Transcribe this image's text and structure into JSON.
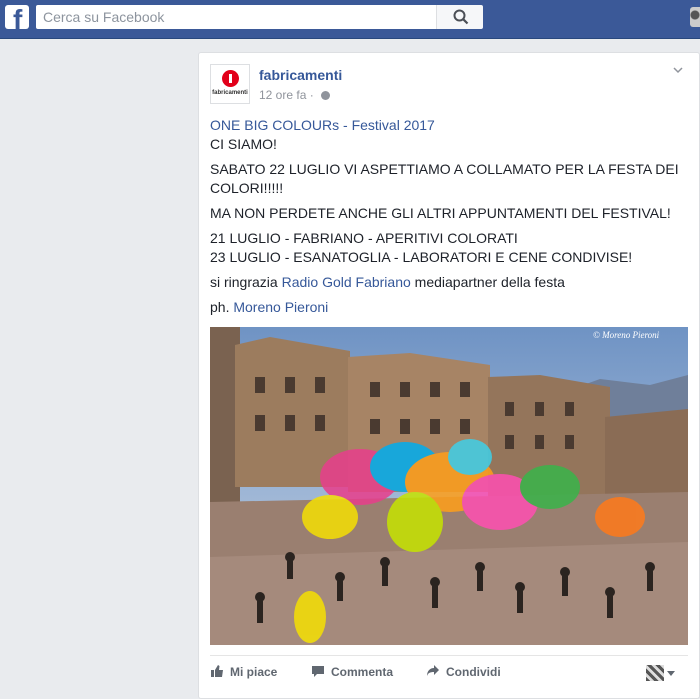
{
  "topbar": {
    "logo": "f",
    "search_placeholder": "Cerca su Facebook",
    "search_icon": "search-icon"
  },
  "post": {
    "page_name": "fabricamenti",
    "logo_text": "fabricamenti",
    "time": "12 ore fa",
    "time_sep": "·",
    "link_line": "ONE BIG COLOURs - Festival 2017",
    "line1": "CI SIAMO!",
    "line2": "SABATO 22 LUGLIO VI ASPETTIAMO A COLLAMATO PER LA FESTA DEI COLORI!!!!!",
    "line3": "MA NON PERDETE ANCHE GLI ALTRI APPUNTAMENTI DEL FESTIVAL!",
    "line4a": "21 LUGLIO - FABRIANO - APERITIVI COLORATI",
    "line4b": "23 LUGLIO - ESANATOGLIA - LABORATORI E CENE CONDIVISE!",
    "thanks_pre": "si ringrazia ",
    "thanks_link": "Radio Gold Fabriano",
    "thanks_post": " mediapartner della festa",
    "ph_pre": "ph. ",
    "ph_link": "Moreno Pieroni",
    "photo_watermark": "© Moreno Pieroni"
  },
  "actions": {
    "like": "Mi piace",
    "comment": "Commenta",
    "share": "Condividi"
  },
  "colors": {
    "brand": "#3b5998",
    "link": "#365899",
    "logo_red": "#e2001a"
  }
}
